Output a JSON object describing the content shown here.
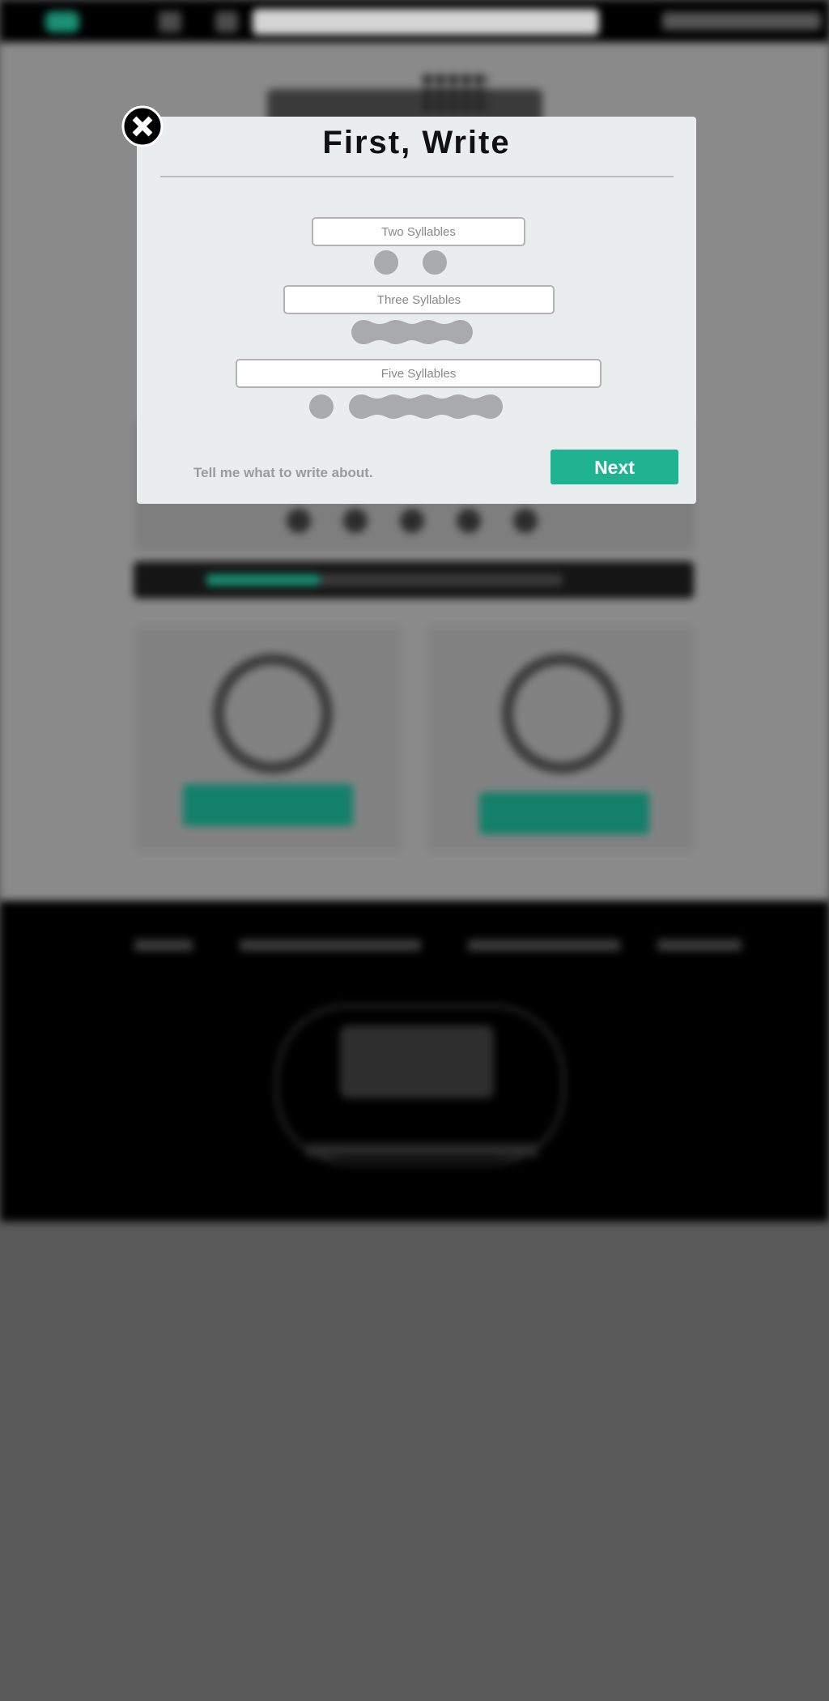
{
  "modal": {
    "title": "First, Write",
    "fields": [
      {
        "placeholder": "Two Syllables",
        "syllables": 2
      },
      {
        "placeholder": "Three Syllables",
        "syllables": 3
      },
      {
        "placeholder": "Five Syllables",
        "syllables": 5
      }
    ],
    "hint": "Tell me what to write about.",
    "next_label": "Next"
  },
  "icons": {
    "close": "close-icon",
    "syllable_marker": "syllable-dot-icon"
  },
  "colors": {
    "accent": "#1fb391",
    "overlay": "#595959",
    "modal_bg": "#eaeded",
    "syllable_marker": "#a8aaab"
  }
}
